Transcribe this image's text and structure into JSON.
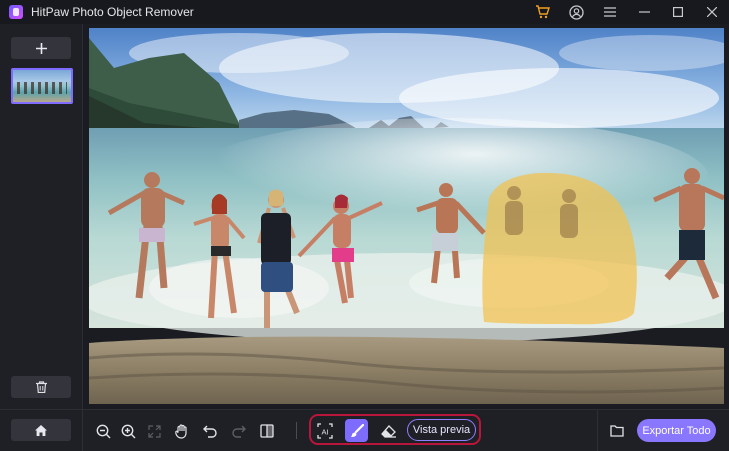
{
  "app": {
    "title": "HitPaw Photo Object Remover",
    "icons": [
      "cart-icon",
      "account-icon",
      "menu-icon",
      "minimize-icon",
      "maximize-icon",
      "close-icon"
    ]
  },
  "sidebar": {
    "add_icon": "plus-icon",
    "thumbnail_alt": "beach photo thumbnail",
    "delete_icon": "trash-icon"
  },
  "toolbar": {
    "tools": [
      "home-icon",
      "zoom-out-icon",
      "zoom-in-icon",
      "fit-screen-icon",
      "hand-icon",
      "undo-icon",
      "redo-icon",
      "compare-icon",
      "ai-select-icon",
      "brush-icon",
      "eraser-icon"
    ],
    "preview_label": "Vista previa",
    "export_label": "Exportar Todo"
  },
  "colors": {
    "accent": "#8a77ff",
    "selection_highlight": "#b8163a",
    "mask": "#f2c14e"
  }
}
